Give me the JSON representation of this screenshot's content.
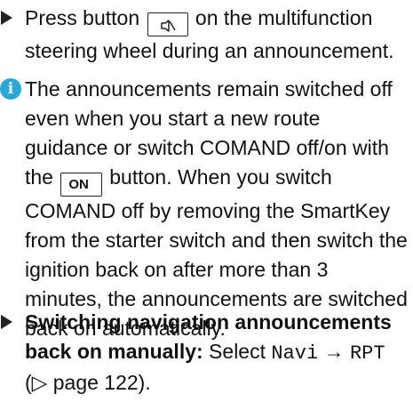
{
  "step1": {
    "text_before": "Press button ",
    "mute_key_icon": "speaker-mute-icon",
    "text_after": " on the multifunction steering wheel during an announcement."
  },
  "note": {
    "icon": "info-icon",
    "icon_glyph": "i",
    "text_before": "The announcements remain switched off even when you start a new route guidance or switch COMAND off/on with the ",
    "on_key_label": "ON",
    "text_after": " button. When you switch COMAND off by removing the SmartKey from the starter switch and then switch the ignition back on after more than 3 minutes, the announcements are switched back on automatically."
  },
  "step2": {
    "bold_label": "Switching navigation announcements back on manually:",
    "select_text": " Select ",
    "menu_navi": "Navi",
    "arrow": " → ",
    "menu_rpt": "RPT",
    "page_ref": "(▷ page 122)."
  }
}
